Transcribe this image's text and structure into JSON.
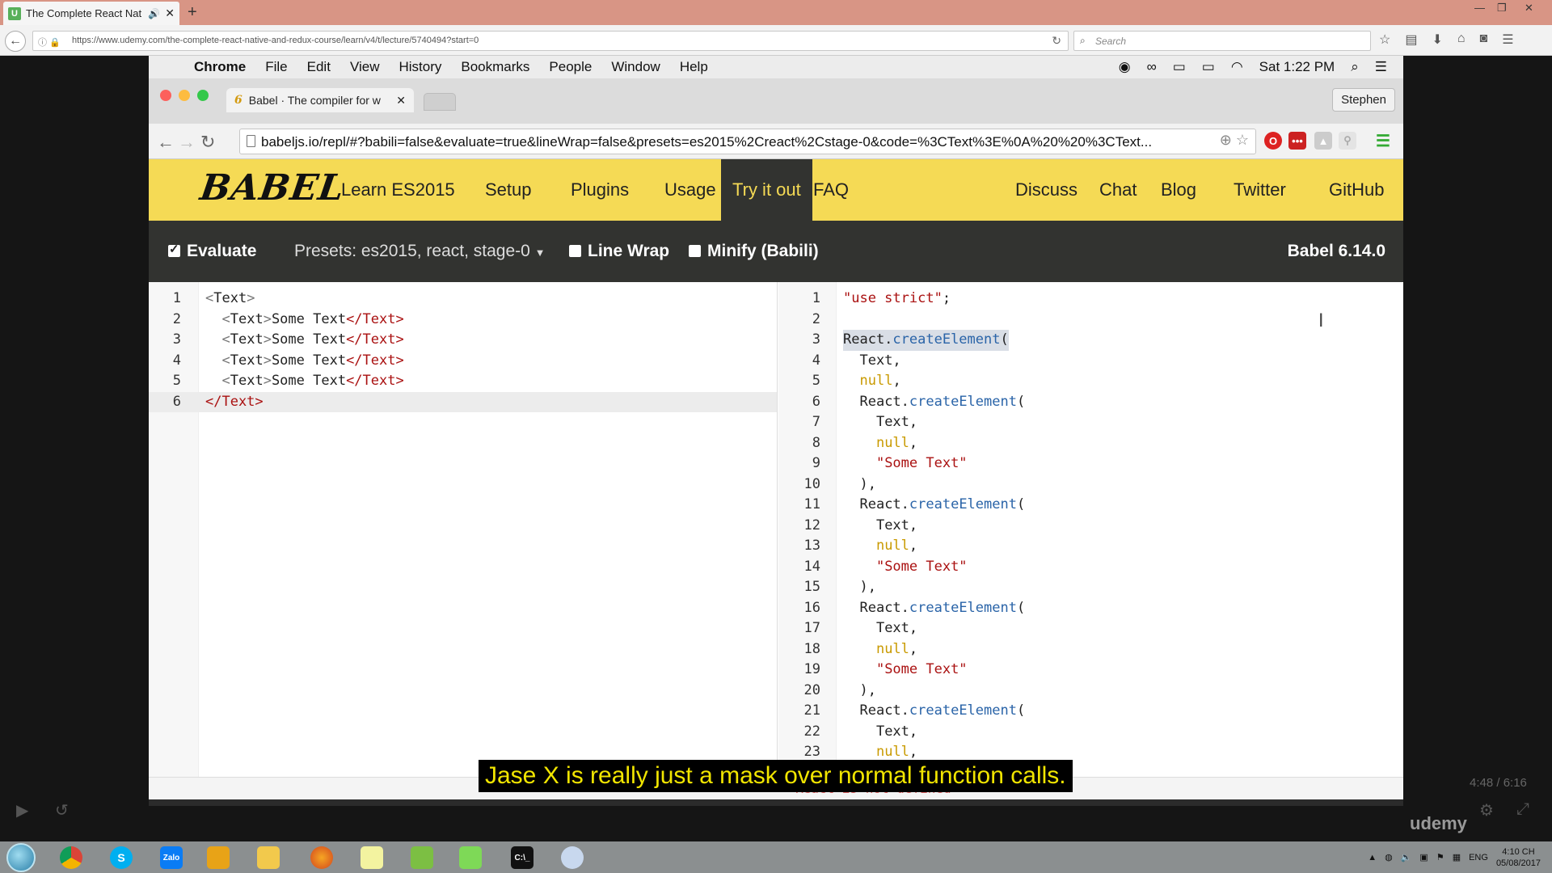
{
  "firefox": {
    "tab_title": "The Complete React Nat",
    "url": "https://www.udemy.com/the-complete-react-native-and-redux-course/learn/v4/t/lecture/5740494?start=0",
    "search_placeholder": "Search"
  },
  "mac_menubar": {
    "app": "Chrome",
    "items": [
      "File",
      "Edit",
      "View",
      "History",
      "Bookmarks",
      "People",
      "Window",
      "Help"
    ],
    "clock": "Sat 1:22 PM"
  },
  "chrome": {
    "tab_title": "Babel · The compiler for w",
    "url": "babeljs.io/repl/#?babili=false&evaluate=true&lineWrap=false&presets=es2015%2Creact%2Cstage-0&code=%3CText%3E%0A%20%20%3CText...",
    "profile": "Stephen"
  },
  "babel": {
    "logo": "BABEL",
    "nav_left": [
      "Learn ES2015",
      "Setup",
      "Plugins",
      "Usage"
    ],
    "nav_active": "Try it out",
    "nav_faq": "FAQ",
    "nav_right": [
      "Discuss",
      "Chat",
      "Blog",
      "Twitter",
      "GitHub"
    ],
    "toolbar": {
      "evaluate": "Evaluate",
      "evaluate_checked": true,
      "presets": "Presets: es2015, react, stage-0",
      "line_wrap": "Line Wrap",
      "minify": "Minify (Babili)",
      "version": "Babel 6.14.0"
    },
    "error": "React is not defined"
  },
  "subtitle": "Jase X is really just a mask over normal function calls.",
  "taskbar": {
    "lang": "ENG",
    "time": "4:10 CH",
    "date": "05/08/2017"
  },
  "overlay": {
    "time": "4:48 / 6:16",
    "watermark": "udemy"
  }
}
